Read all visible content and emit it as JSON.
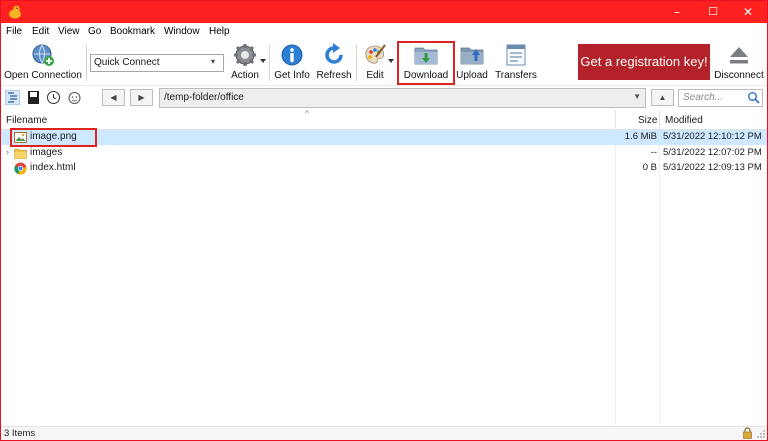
{
  "titlebar": {
    "minimize_glyph": "–",
    "maximize_glyph": "☐",
    "close_glyph": "✕",
    "background": "#ff2020"
  },
  "menu": {
    "items": [
      "File",
      "Edit",
      "View",
      "Go",
      "Bookmark",
      "Window",
      "Help"
    ]
  },
  "toolbar": {
    "open_connection": "Open Connection",
    "quick_connect": "Quick Connect",
    "action": "Action",
    "get_info": "Get Info",
    "refresh": "Refresh",
    "edit": "Edit",
    "download": "Download",
    "upload": "Upload",
    "transfers": "Transfers",
    "registration": "Get a registration key!",
    "disconnect": "Disconnect"
  },
  "pathbar": {
    "back_glyph": "◀",
    "forward_glyph": "▶",
    "path": "/temp-folder/office",
    "dropdown_glyph": "▼",
    "up_glyph": "▲",
    "search_placeholder": "Search..."
  },
  "columns": {
    "filename": "Filename",
    "size": "Size",
    "modified": "Modified",
    "sort_glyph": "^"
  },
  "files": [
    {
      "name": "image.png",
      "size": "1.6 MiB",
      "modified": "5/31/2022 12:10:12 PM",
      "icon": "image-file-icon",
      "expand": ""
    },
    {
      "name": "images",
      "size": "--",
      "modified": "5/31/2022 12:07:02 PM",
      "icon": "folder-icon",
      "expand": "›"
    },
    {
      "name": "index.html",
      "size": "0 B",
      "modified": "5/31/2022 12:09:13 PM",
      "icon": "chrome-html-icon",
      "expand": ""
    }
  ],
  "status": {
    "items": "3 Items"
  },
  "colors": {
    "accent_red": "#ff2020",
    "highlight_red": "#e0231f",
    "registration_bg": "#b3222a",
    "selection_bg": "#cde8ff"
  }
}
